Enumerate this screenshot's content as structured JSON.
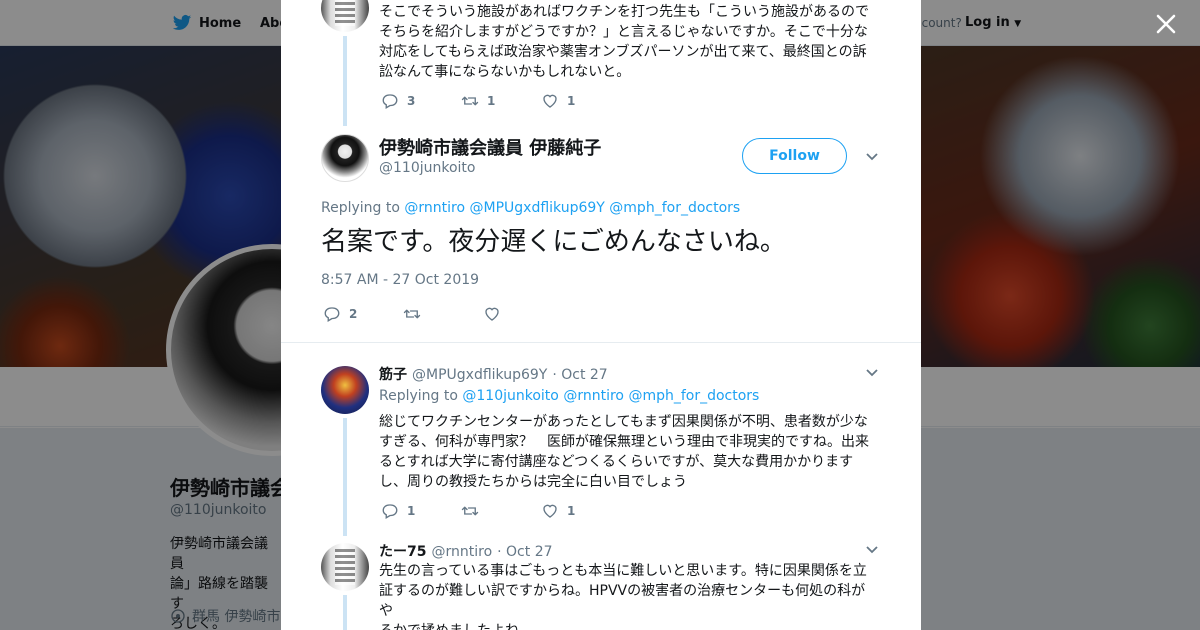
{
  "nav": {
    "home_label": "Home",
    "about_label": "Abo",
    "account_text": "ccount?",
    "login_label": "Log in"
  },
  "profile_bg": {
    "name": "伊勢崎市議会",
    "handle": "@110junkoito",
    "bio_lines": [
      "伊勢崎市議会議員",
      "論」路線を踏襲す",
      "ろしく。"
    ],
    "location": "群馬 伊勢崎市"
  },
  "thread": {
    "prev_tweet": {
      "text_lines": [
        "そこでそういう施設があればワクチンを打つ先生も「こういう施設があるので",
        "そちらを紹介しますがどうですか？」と言えるじゃないですか。そこで十分な",
        "対応をしてもらえば政治家や薬害オンブズパーソンが出て来て、最終国との訴",
        "訟なんて事にならないかもしれないと。"
      ],
      "replies": "3",
      "retweets": "1",
      "likes": "1"
    },
    "main_tweet": {
      "name": "伊勢崎市議会議員 伊藤純子",
      "handle": "@110junkoito",
      "follow_label": "Follow",
      "replying_prefix": "Replying to",
      "replying_to": [
        "@rnntiro",
        "@MPUgxdflikup69Y",
        "@mph_for_doctors"
      ],
      "text": "名案です。夜分遅くにごめんなさいね。",
      "timestamp": "8:57 AM - 27 Oct 2019",
      "replies": "2",
      "retweets": "",
      "likes": ""
    },
    "reply1": {
      "name": "筋子",
      "handle": "@MPUgxdflikup69Y",
      "date": "· Oct 27",
      "replying_prefix": "Replying to",
      "replying_to": [
        "@110junkoito",
        "@rnntiro",
        "@mph_for_doctors"
      ],
      "text_lines": [
        "総じてワクチンセンターがあったとしてもまず因果関係が不明、患者数が少な",
        "すぎる、何科が専門家？　医師が確保無理という理由で非現実的ですね。出来",
        "るとすれば大学に寄付講座などつくるくらいですが、莫大な費用かかります",
        "し、周りの教授たちからは完全に白い目でしょう"
      ],
      "replies": "1",
      "retweets": "",
      "likes": "1"
    },
    "reply2": {
      "name": "たー75",
      "handle": "@rnntiro",
      "date": "· Oct 27",
      "text_lines": [
        "先生の言っている事はごもっとも本当に難しいと思います。特に因果関係を立",
        "証するのが難しい訳ですからね。HPVVの被害者の治療センターも何処の科がや",
        "るかで揉めましたよね。"
      ]
    }
  },
  "colors": {
    "accent": "#1da1f2",
    "muted": "#657786",
    "thread_line": "#cce3f4"
  }
}
